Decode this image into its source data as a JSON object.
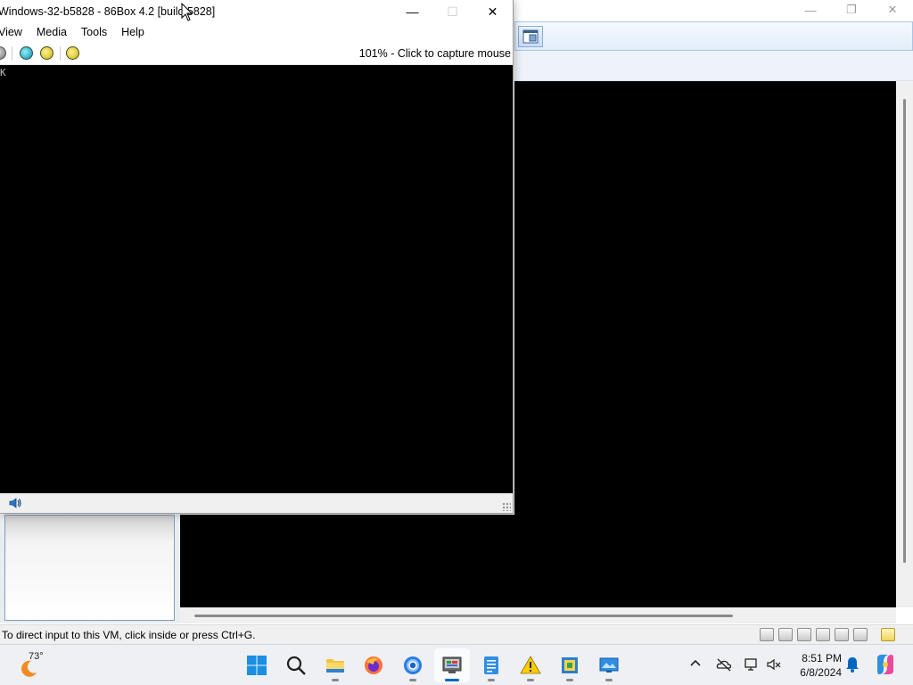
{
  "box_window": {
    "title": "Windows-32-b5828 - 86Box 4.2 [build 5828]",
    "menu": [
      "View",
      "Media",
      "Tools",
      "Help"
    ],
    "capture_hint": "101% - Click to capture mouse",
    "screen_cursor": "K"
  },
  "manager_window": {
    "status_text": "To direct input to this VM, click inside or press Ctrl+G."
  },
  "taskbar": {
    "weather_temp": "73°",
    "clock_time": "8:51 PM",
    "clock_date": "6/8/2024",
    "apps": [
      "start-icon",
      "search-icon",
      "file-explorer-icon",
      "firefox-icon",
      "chrome-icon",
      "86box-manager-icon",
      "notepad-icon",
      "warning-app-icon",
      "vm-app-icon",
      "display-app-icon"
    ]
  },
  "colors": {
    "screen": "#000000",
    "taskbar": "#eef0f4",
    "accent": "#0067c0"
  }
}
